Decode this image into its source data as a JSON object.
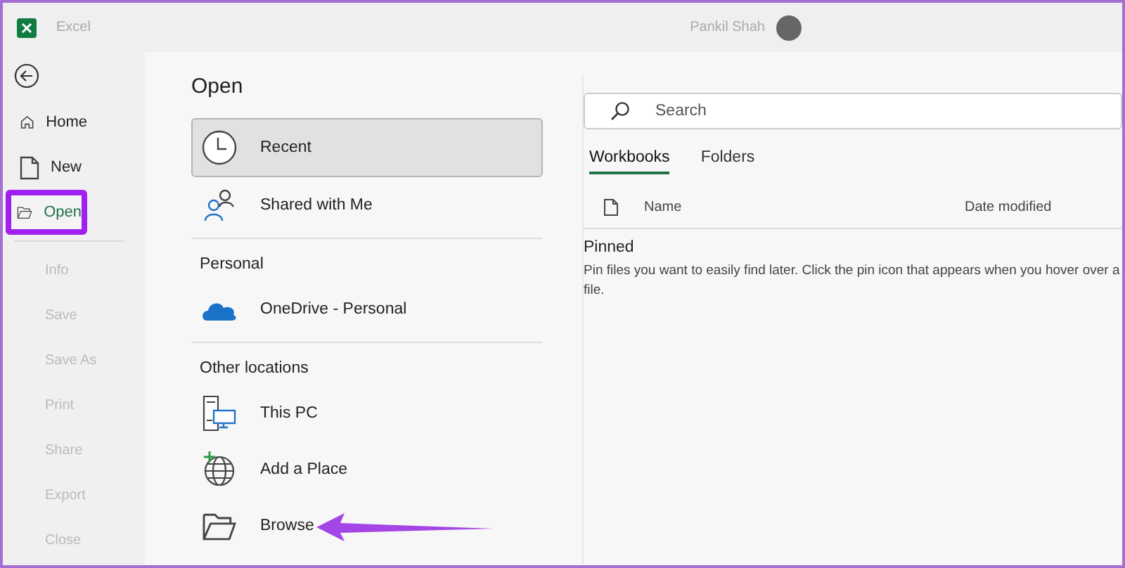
{
  "window": {
    "app": "Excel",
    "user": "Pankil Shah"
  },
  "nav": {
    "primary": [
      {
        "label": "Home",
        "selected": false,
        "highlighted": false
      },
      {
        "label": "New",
        "selected": false,
        "highlighted": false
      },
      {
        "label": "Open",
        "selected": true,
        "highlighted": true
      }
    ],
    "secondary": [
      {
        "label": "Info",
        "disabled": true
      },
      {
        "label": "Save",
        "disabled": true
      },
      {
        "label": "Save As",
        "disabled": true
      },
      {
        "label": "Print",
        "disabled": true
      },
      {
        "label": "Share",
        "disabled": true
      },
      {
        "label": "Export",
        "disabled": true
      },
      {
        "label": "Close",
        "disabled": true
      }
    ]
  },
  "page_title": "Open",
  "locations": [
    {
      "kind": "item",
      "label": "Recent",
      "selected": true,
      "pointed": false
    },
    {
      "kind": "item",
      "label": "Shared with Me",
      "selected": false,
      "pointed": false
    },
    {
      "kind": "header",
      "label": "Personal"
    },
    {
      "kind": "item",
      "label": "OneDrive - Personal",
      "selected": false,
      "pointed": false
    },
    {
      "kind": "header",
      "label": "Other locations"
    },
    {
      "kind": "item",
      "label": "This PC",
      "selected": false,
      "pointed": false
    },
    {
      "kind": "item",
      "label": "Add a Place",
      "selected": false,
      "pointed": false
    },
    {
      "kind": "item",
      "label": "Browse",
      "selected": false,
      "pointed": true
    }
  ],
  "search": {
    "placeholder": "Search"
  },
  "tabs": [
    {
      "label": "Workbooks",
      "selected": true
    },
    {
      "label": "Folders",
      "selected": false
    }
  ],
  "table": {
    "columns": [
      "Name",
      "Date modified"
    ]
  },
  "pinned": {
    "title": "Pinned",
    "text": "Pin files you want to easily find later. Click the pin icon that appears when you hover over a file."
  }
}
